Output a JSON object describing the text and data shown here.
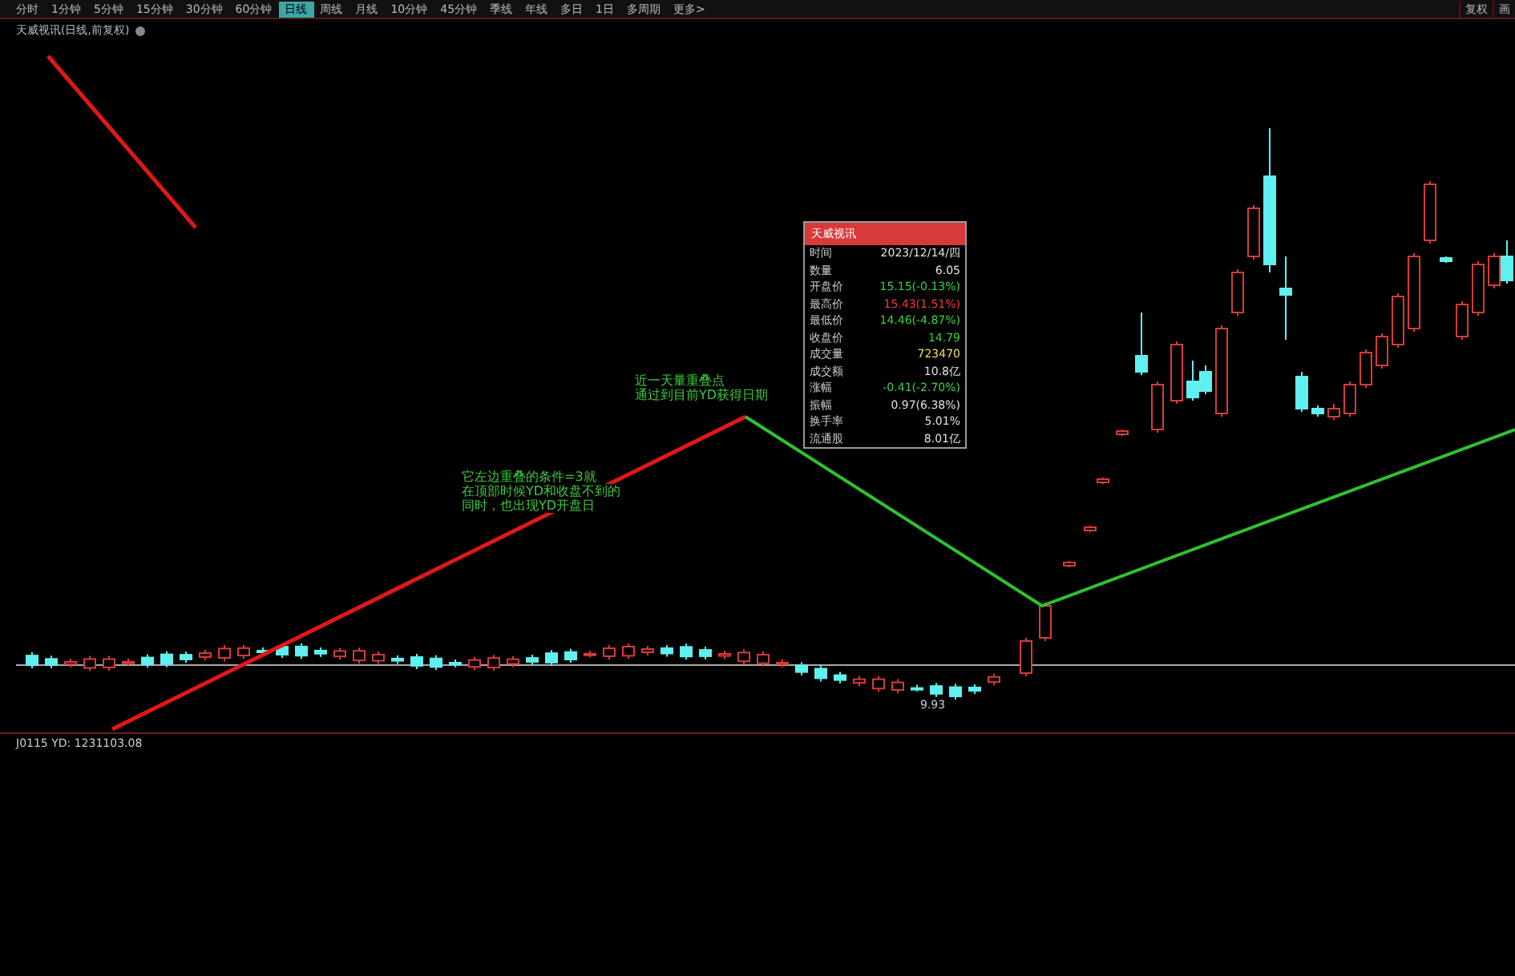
{
  "toolbar": {
    "tabs": [
      {
        "label": "分时",
        "selected": false
      },
      {
        "label": "1分钟",
        "selected": false
      },
      {
        "label": "5分钟",
        "selected": false
      },
      {
        "label": "15分钟",
        "selected": false
      },
      {
        "label": "30分钟",
        "selected": false
      },
      {
        "label": "60分钟",
        "selected": false
      },
      {
        "label": "日线",
        "selected": true
      },
      {
        "label": "周线",
        "selected": false
      },
      {
        "label": "月线",
        "selected": false
      },
      {
        "label": "10分钟",
        "selected": false
      },
      {
        "label": "45分钟",
        "selected": false
      },
      {
        "label": "季线",
        "selected": false
      },
      {
        "label": "年线",
        "selected": false
      },
      {
        "label": "多日",
        "selected": false
      },
      {
        "label": "1日",
        "selected": false
      },
      {
        "label": "多周期",
        "selected": false
      },
      {
        "label": "更多>",
        "selected": false
      }
    ],
    "right_buttons": [
      "复权",
      "画"
    ]
  },
  "chart_title": "天威视讯(日线,前复权)",
  "popup": {
    "title": "天威视讯",
    "rows": [
      {
        "label": "时间",
        "value": "2023/12/14/四",
        "color": "#e0e0e0"
      },
      {
        "label": "数量",
        "value": "6.05",
        "color": "#e0e0e0"
      },
      {
        "label": "开盘价",
        "value": "15.15(-0.13%)",
        "color": "#3cd23c"
      },
      {
        "label": "最高价",
        "value": "15.43(1.51%)",
        "color": "#f03c3c"
      },
      {
        "label": "最低价",
        "value": "14.46(-4.87%)",
        "color": "#3cd23c"
      },
      {
        "label": "收盘价",
        "value": "14.79",
        "color": "#3cd23c"
      },
      {
        "label": "成交量",
        "value": "723470",
        "color": "#e8e060"
      },
      {
        "label": "成交额",
        "value": "10.8亿",
        "color": "#e0e0e0"
      },
      {
        "label": "涨幅",
        "value": "-0.41(-2.70%)",
        "color": "#3cd23c"
      },
      {
        "label": "振幅",
        "value": "0.97(6.38%)",
        "color": "#e0e0e0"
      },
      {
        "label": "换手率",
        "value": "5.01%",
        "color": "#e0e0e0"
      },
      {
        "label": "流通股",
        "value": "8.01亿",
        "color": "#e0e0e0"
      }
    ]
  },
  "annotations": [
    {
      "lines": [
        "近一天量重叠点",
        "通过到目前YD获得日期"
      ]
    },
    {
      "lines": [
        "它左边重叠的条件=3就",
        "在顶部时候YD和收盘不到的",
        "同时，也出现YD开盘日"
      ]
    }
  ],
  "low_price_label": "9.93",
  "indicator_label": "J0115 YD: 1231103.08"
}
